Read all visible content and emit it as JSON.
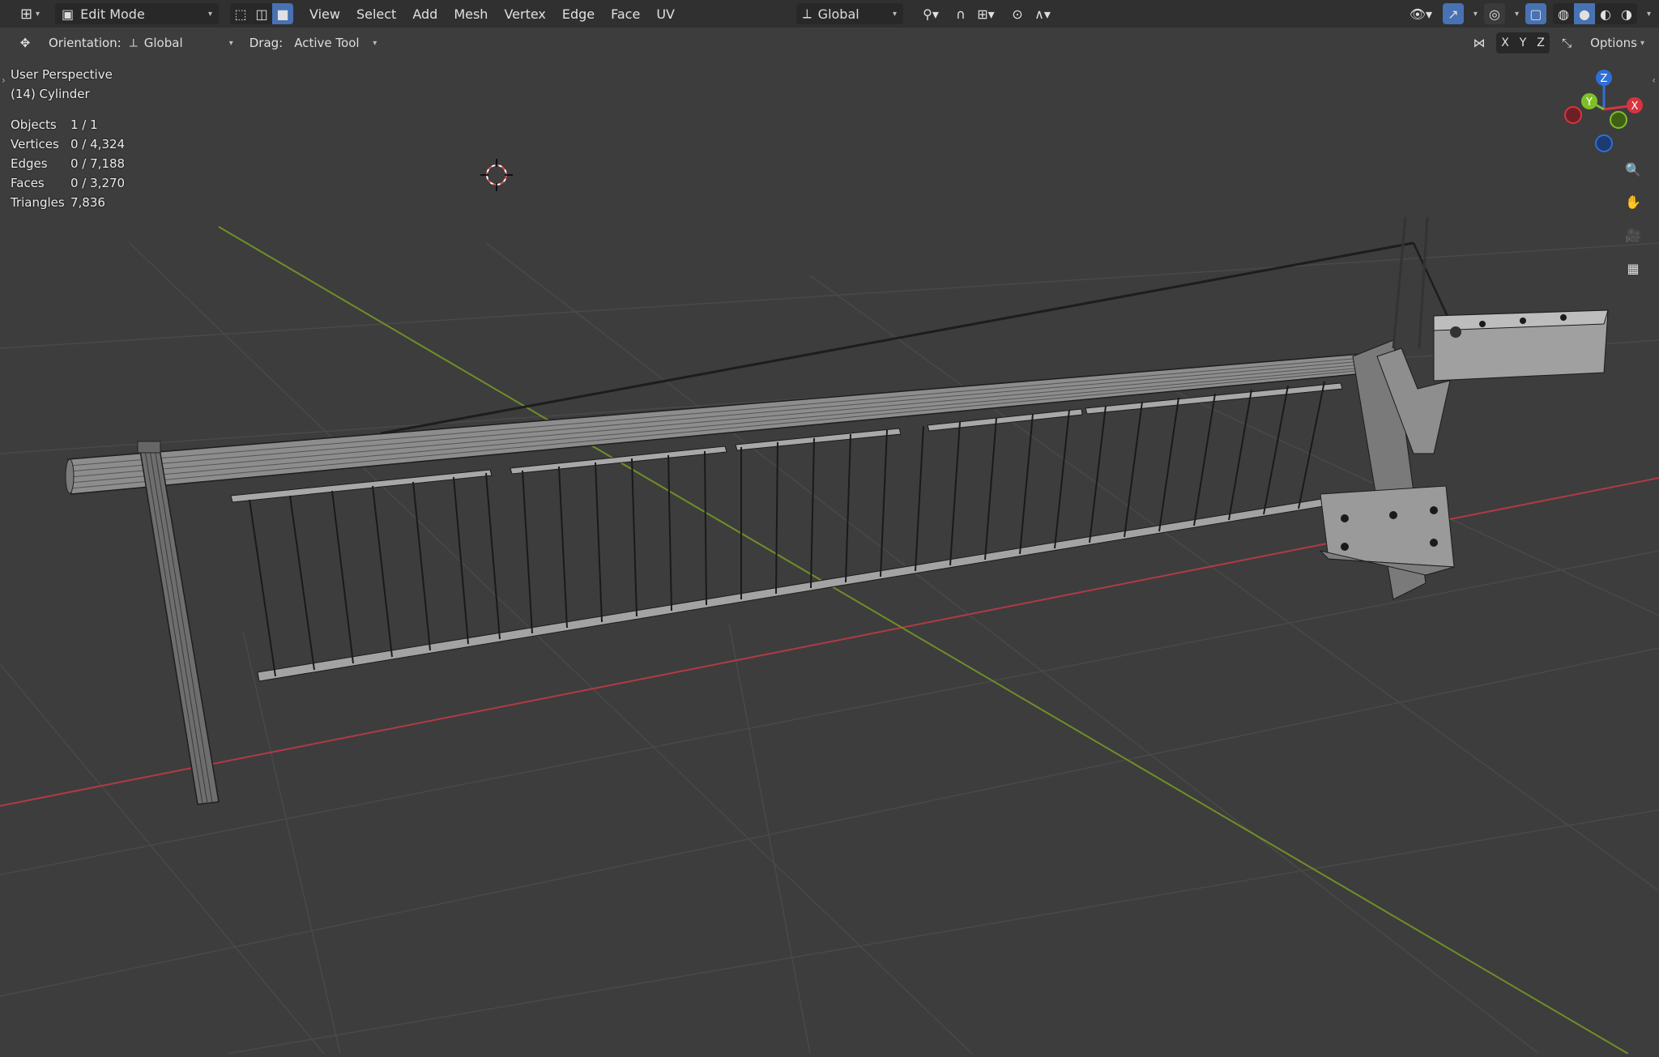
{
  "header": {
    "editor_type_icon": "viewport-editor-icon",
    "mode": "Edit Mode",
    "menus": [
      "View",
      "Select",
      "Add",
      "Mesh",
      "Vertex",
      "Edge",
      "Face",
      "UV"
    ],
    "transform_orientation": "Global",
    "options_label": "Options"
  },
  "tool_settings": {
    "orientation_label": "Orientation:",
    "orientation_value": "Global",
    "drag_label": "Drag:",
    "drag_value": "Active Tool",
    "axes": [
      "X",
      "Y",
      "Z"
    ]
  },
  "overlay": {
    "view_name": "User Perspective",
    "object_name": "(14) Cylinder"
  },
  "stats": [
    {
      "key": "Objects",
      "value": "1 / 1"
    },
    {
      "key": "Vertices",
      "value": "0 / 4,324"
    },
    {
      "key": "Edges",
      "value": "0 / 7,188"
    },
    {
      "key": "Faces",
      "value": "0 / 3,270"
    },
    {
      "key": "Triangles",
      "value": "7,836"
    }
  ],
  "gizmo": {
    "x": "X",
    "y": "Y",
    "z": "Z"
  },
  "colors": {
    "viewport_bg": "#3d3d3d",
    "header_bg": "#303030",
    "grid": "#4a4a4a",
    "x_axis": "#c0424f",
    "y_axis": "#7a9a2c",
    "active": "#4772b3"
  }
}
